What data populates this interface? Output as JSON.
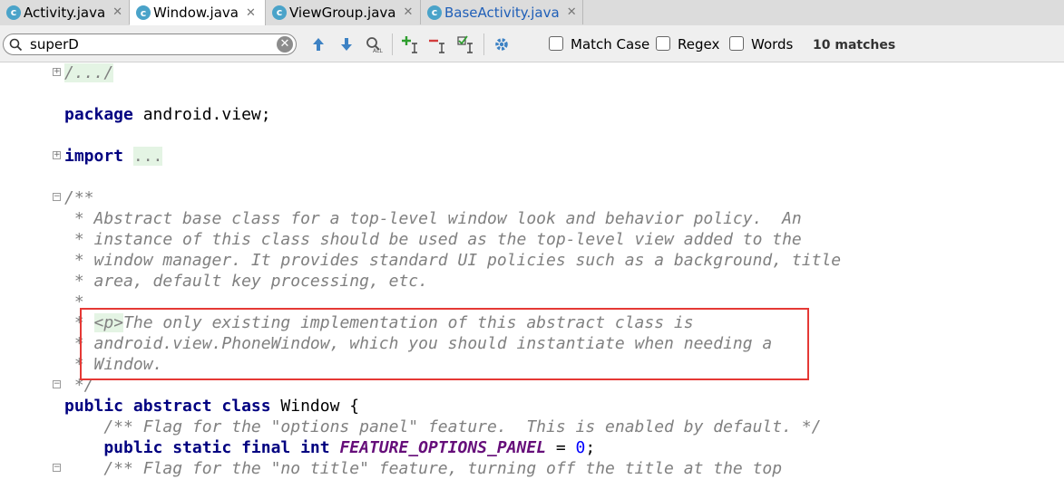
{
  "tabs": [
    {
      "icon": "c",
      "label": "Activity.java",
      "close": "✕",
      "active": false,
      "color": "#000000"
    },
    {
      "icon": "c",
      "label": "Window.java",
      "close": "✕",
      "active": true,
      "color": "#000000"
    },
    {
      "icon": "c",
      "label": "ViewGroup.java",
      "close": "✕",
      "active": false,
      "color": "#000000"
    },
    {
      "icon": "c",
      "label": "BaseActivity.java",
      "close": "✕",
      "active": false,
      "color": "#1f5fb8"
    }
  ],
  "find": {
    "query": "superD",
    "match_case_label": "Match Case",
    "regex_label": "Regex",
    "words_label": "Words",
    "match_count": "10 matches",
    "match_case_checked": false,
    "regex_checked": false,
    "words_checked": false
  },
  "code": {
    "l1": "/.../",
    "l2_kw": "package",
    "l2_rest": " android.view;",
    "l3_kw": "import",
    "l3_rest": "...",
    "c1": "/**",
    "c2": " * Abstract base class for a top-level window look and behavior policy.  An",
    "c3": " * instance of this class should be used as the top-level view added to the",
    "c4": " * window manager. It provides standard UI policies such as a background, title",
    "c5": " * area, default key processing, etc.",
    "c6": " *",
    "c7_star": " * ",
    "c7_tag": "<p>",
    "c7_rest": "The only existing implementation of this abstract class is",
    "c8": " * android.view.PhoneWindow, which you should instantiate when needing a",
    "c9": " * Window.",
    "c10": " */",
    "d1_kw": "public abstract class",
    "d1_rest": " Window {",
    "d2": "    /** Flag for the \"options panel\" feature.  This is enabled by default. */",
    "d3_kw": "    public static final int",
    "d3_field": "FEATURE_OPTIONS_PANEL",
    "d3_eq": " = ",
    "d3_num": "0",
    "d3_end": ";",
    "d4": "    /** Flag for the \"no title\" feature, turning off the title at the top"
  }
}
